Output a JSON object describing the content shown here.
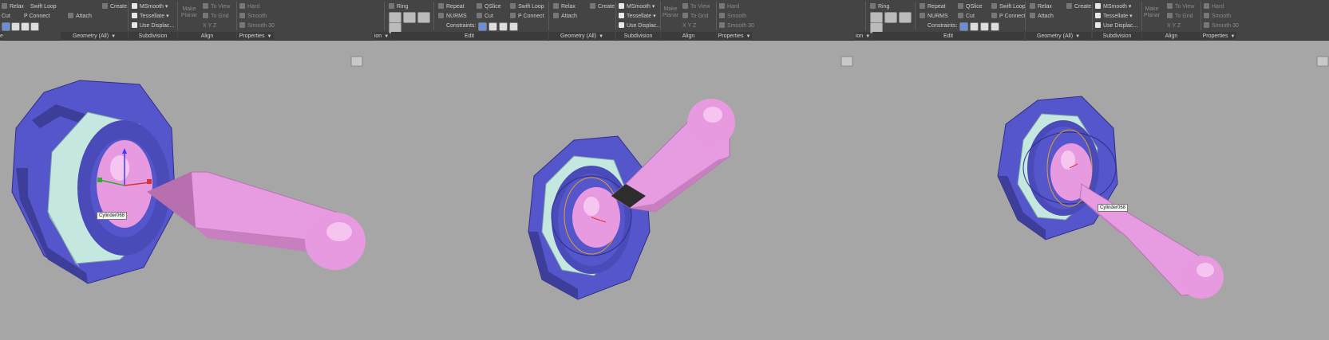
{
  "panels": [
    {
      "ribbon": {
        "sections": [
          "Geometry (All)",
          "Subdivision",
          "Align",
          "Properties"
        ],
        "items": {
          "relax": "Relax",
          "create": "Create",
          "swift_loop": "Swift Loop",
          "cut": "Cut",
          "p_connect": "P Connect",
          "attach": "Attach",
          "msmooth": "MSmooth",
          "tessellate": "Tessellate",
          "use_displac": "Use Displac...",
          "make_planar": "Make Planar",
          "to_view": "To View",
          "to_grid": "To Grid",
          "hard": "Hard",
          "smooth": "Smooth",
          "smooth30": "Smooth 30"
        }
      },
      "label": "Cylinder068"
    },
    {
      "ribbon": {
        "sections": [
          "Edit",
          "Geometry (All)",
          "Subdivision",
          "Align",
          "Properties"
        ],
        "items": {
          "ring": "Ring",
          "repeat": "Repeat",
          "qslice": "QSlice",
          "swift_loop": "Swift Loop",
          "nurms": "NURMS",
          "cut": "Cut",
          "p_connect": "P Connect",
          "constraints": "Constraints:",
          "relax": "Relax",
          "create": "Create",
          "attach": "Attach",
          "msmooth": "MSmooth",
          "tessellate": "Tessellate",
          "use_displac": "Use Displac...",
          "make_planar": "Make Planar",
          "to_view": "To View",
          "to_grid": "To Grid",
          "hard": "Hard",
          "smooth": "Smooth",
          "smooth30": "Smooth 30"
        }
      }
    },
    {
      "ribbon": {
        "sections": [
          "Edit",
          "Geometry (All)",
          "Subdivision",
          "Align",
          "Properties"
        ],
        "items": {
          "ring": "Ring",
          "repeat": "Repeat",
          "qslice": "QSlice",
          "swift_loop": "Swift Loop",
          "nurms": "NURMS",
          "cut": "Cut",
          "p_connect": "P Connect",
          "constraints": "Constraints:",
          "relax": "Relax",
          "create": "Create",
          "attach": "Attach",
          "msmooth": "MSmooth",
          "tessellate": "Tessellate",
          "use_displac": "Use Displac...",
          "make_planar": "Make Planar",
          "to_view": "To View",
          "to_grid": "To Grid",
          "hard": "Hard",
          "smooth": "Smooth",
          "smooth30": "Smooth 30"
        }
      },
      "label": "Cylinder068"
    }
  ],
  "colors": {
    "ribbon": "#444444",
    "viewport": "#a6a6a6",
    "washer": "#5555cc",
    "nut": "#c4e8e0",
    "ball": "#e89ae0",
    "lever": "#e79be0"
  }
}
